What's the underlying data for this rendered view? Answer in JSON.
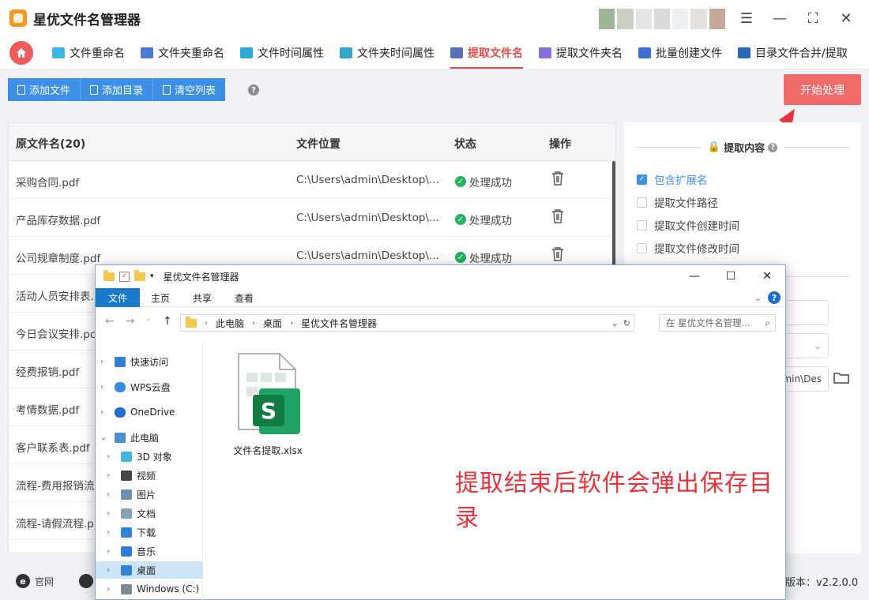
{
  "app": {
    "title": "星优文件名管理器"
  },
  "window_controls": {
    "settings": "☰",
    "minimize": "—",
    "maximize": "⛶",
    "close": "✕"
  },
  "tabs": [
    {
      "label": "文件重命名",
      "color": "#3db7e8"
    },
    {
      "label": "文件夹重命名",
      "color": "#4a7bd1"
    },
    {
      "label": "文件时间属性",
      "color": "#2fa8d8"
    },
    {
      "label": "文件夹时间属性",
      "color": "#35a6c9"
    },
    {
      "label": "提取文件名",
      "color": "#5b6fb8",
      "active": true
    },
    {
      "label": "提取文件夹名",
      "color": "#8a6fd6"
    },
    {
      "label": "批量创建文件",
      "color": "#3e6fd1"
    },
    {
      "label": "目录文件合并/提取",
      "color": "#2b69b6"
    }
  ],
  "toolbar": {
    "add_file": "添加文件",
    "add_dir": "添加目录",
    "clear_list": "清空列表",
    "help": "?",
    "start": "开始处理"
  },
  "table": {
    "headers": {
      "name": "原文件名(20)",
      "path": "文件位置",
      "status": "状态",
      "op": "操作"
    },
    "rows": [
      {
        "name": "采购合同.pdf",
        "path": "C:\\Users\\admin\\Desktop\\...",
        "status": "处理成功"
      },
      {
        "name": "产品库存数据.pdf",
        "path": "C:\\Users\\admin\\Desktop\\...",
        "status": "处理成功"
      },
      {
        "name": "公司规章制度.pdf",
        "path": "C:\\Users\\admin\\Desktop\\...",
        "status": "处理成功"
      },
      {
        "name": "活动人员安排表.",
        "path": "",
        "status": ""
      },
      {
        "name": "今日会议安排.pc",
        "path": "",
        "status": ""
      },
      {
        "name": "经费报销.pdf",
        "path": "",
        "status": ""
      },
      {
        "name": "考情数据.pdf",
        "path": "",
        "status": ""
      },
      {
        "name": "客户联系表.pdf",
        "path": "",
        "status": ""
      },
      {
        "name": "流程-费用报销流",
        "path": "",
        "status": ""
      },
      {
        "name": "流程-请假流程.p",
        "path": "",
        "status": ""
      }
    ]
  },
  "settings": {
    "section_title": "提取内容",
    "help": "?",
    "options": [
      {
        "label": "包含扩展名",
        "checked": true
      },
      {
        "label": "提取文件路径",
        "checked": false
      },
      {
        "label": "提取文件创建时间",
        "checked": false
      },
      {
        "label": "提取文件修改时间",
        "checked": false
      }
    ],
    "output_path_value": "min\\Des"
  },
  "footer": {
    "site": "官网",
    "version": "版本：v2.2.0.0"
  },
  "explorer": {
    "title": "星优文件名管理器",
    "ribbon": {
      "file": "文件",
      "home": "主页",
      "share": "共享",
      "view": "查看"
    },
    "address": [
      "此电脑",
      "桌面",
      "星优文件名管理器"
    ],
    "search_placeholder": "在 星优文件名管理...",
    "nav": [
      {
        "label": "快速访问",
        "level": 0,
        "color": "#2f7fd8"
      },
      {
        "label": "WPS云盘",
        "level": 0,
        "color": "#3a8ee6"
      },
      {
        "label": "OneDrive",
        "level": 0,
        "color": "#1e6fcf"
      },
      {
        "label": "此电脑",
        "level": 0,
        "color": "#4a90d9",
        "expanded": true
      },
      {
        "label": "3D 对象",
        "level": 1,
        "color": "#48b7e0"
      },
      {
        "label": "视频",
        "level": 1,
        "color": "#444444"
      },
      {
        "label": "图片",
        "level": 1,
        "color": "#6d8fb3"
      },
      {
        "label": "文档",
        "level": 1,
        "color": "#8aa0b8"
      },
      {
        "label": "下载",
        "level": 1,
        "color": "#2f86d8"
      },
      {
        "label": "音乐",
        "level": 1,
        "color": "#2f7fd8"
      },
      {
        "label": "桌面",
        "level": 1,
        "color": "#2f86d8",
        "selected": true
      },
      {
        "label": "Windows (C:)",
        "level": 1,
        "color": "#7a8a99"
      }
    ],
    "file": {
      "label": "文件名提取.xlsx"
    },
    "annotation": "提取结束后软件会弹出保存目录"
  }
}
